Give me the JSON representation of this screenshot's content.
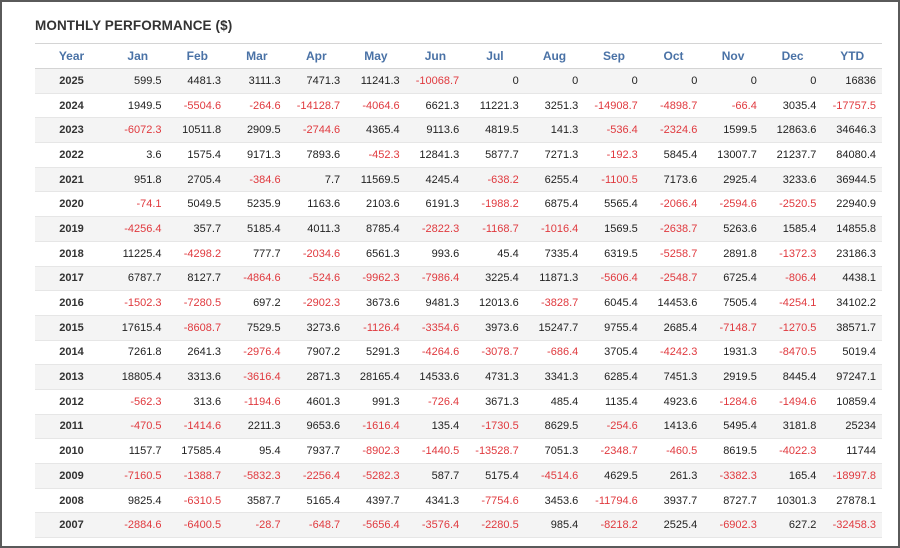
{
  "title": "MONTHLY PERFORMANCE ($)",
  "columns": [
    "Year",
    "Jan",
    "Feb",
    "Mar",
    "Apr",
    "May",
    "Jun",
    "Jul",
    "Aug",
    "Sep",
    "Oct",
    "Nov",
    "Dec",
    "YTD"
  ],
  "rows": [
    [
      "2025",
      "599.5",
      "4481.3",
      "3111.3",
      "7471.3",
      "11241.3",
      "-10068.7",
      "0",
      "0",
      "0",
      "0",
      "0",
      "0",
      "16836"
    ],
    [
      "2024",
      "1949.5",
      "-5504.6",
      "-264.6",
      "-14128.7",
      "-4064.6",
      "6621.3",
      "11221.3",
      "3251.3",
      "-14908.7",
      "-4898.7",
      "-66.4",
      "3035.4",
      "-17757.5"
    ],
    [
      "2023",
      "-6072.3",
      "10511.8",
      "2909.5",
      "-2744.6",
      "4365.4",
      "9113.6",
      "4819.5",
      "141.3",
      "-536.4",
      "-2324.6",
      "1599.5",
      "12863.6",
      "34646.3"
    ],
    [
      "2022",
      "3.6",
      "1575.4",
      "9171.3",
      "7893.6",
      "-452.3",
      "12841.3",
      "5877.7",
      "7271.3",
      "-192.3",
      "5845.4",
      "13007.7",
      "21237.7",
      "84080.4"
    ],
    [
      "2021",
      "951.8",
      "2705.4",
      "-384.6",
      "7.7",
      "11569.5",
      "4245.4",
      "-638.2",
      "6255.4",
      "-1100.5",
      "7173.6",
      "2925.4",
      "3233.6",
      "36944.5"
    ],
    [
      "2020",
      "-74.1",
      "5049.5",
      "5235.9",
      "1163.6",
      "2103.6",
      "6191.3",
      "-1988.2",
      "6875.4",
      "5565.4",
      "-2066.4",
      "-2594.6",
      "-2520.5",
      "22940.9"
    ],
    [
      "2019",
      "-4256.4",
      "357.7",
      "5185.4",
      "4011.3",
      "8785.4",
      "-2822.3",
      "-1168.7",
      "-1016.4",
      "1569.5",
      "-2638.7",
      "5263.6",
      "1585.4",
      "14855.8"
    ],
    [
      "2018",
      "11225.4",
      "-4298.2",
      "777.7",
      "-2034.6",
      "6561.3",
      "993.6",
      "45.4",
      "7335.4",
      "6319.5",
      "-5258.7",
      "2891.8",
      "-1372.3",
      "23186.3"
    ],
    [
      "2017",
      "6787.7",
      "8127.7",
      "-4864.6",
      "-524.6",
      "-9962.3",
      "-7986.4",
      "3225.4",
      "11871.3",
      "-5606.4",
      "-2548.7",
      "6725.4",
      "-806.4",
      "4438.1"
    ],
    [
      "2016",
      "-1502.3",
      "-7280.5",
      "697.2",
      "-2902.3",
      "3673.6",
      "9481.3",
      "12013.6",
      "-3828.7",
      "6045.4",
      "14453.6",
      "7505.4",
      "-4254.1",
      "34102.2"
    ],
    [
      "2015",
      "17615.4",
      "-8608.7",
      "7529.5",
      "3273.6",
      "-1126.4",
      "-3354.6",
      "3973.6",
      "15247.7",
      "9755.4",
      "2685.4",
      "-7148.7",
      "-1270.5",
      "38571.7"
    ],
    [
      "2014",
      "7261.8",
      "2641.3",
      "-2976.4",
      "7907.2",
      "5291.3",
      "-4264.6",
      "-3078.7",
      "-686.4",
      "3705.4",
      "-4242.3",
      "1931.3",
      "-8470.5",
      "5019.4"
    ],
    [
      "2013",
      "18805.4",
      "3313.6",
      "-3616.4",
      "2871.3",
      "28165.4",
      "14533.6",
      "4731.3",
      "3341.3",
      "6285.4",
      "7451.3",
      "2919.5",
      "8445.4",
      "97247.1"
    ],
    [
      "2012",
      "-562.3",
      "313.6",
      "-1194.6",
      "4601.3",
      "991.3",
      "-726.4",
      "3671.3",
      "485.4",
      "1135.4",
      "4923.6",
      "-1284.6",
      "-1494.6",
      "10859.4"
    ],
    [
      "2011",
      "-470.5",
      "-1414.6",
      "2211.3",
      "9653.6",
      "-1616.4",
      "135.4",
      "-1730.5",
      "8629.5",
      "-254.6",
      "1413.6",
      "5495.4",
      "3181.8",
      "25234"
    ],
    [
      "2010",
      "1157.7",
      "17585.4",
      "95.4",
      "7937.7",
      "-8902.3",
      "-1440.5",
      "-13528.7",
      "7051.3",
      "-2348.7",
      "-460.5",
      "8619.5",
      "-4022.3",
      "11744"
    ],
    [
      "2009",
      "-7160.5",
      "-1388.7",
      "-5832.3",
      "-2256.4",
      "-5282.3",
      "587.7",
      "5175.4",
      "-4514.6",
      "4629.5",
      "261.3",
      "-3382.3",
      "165.4",
      "-18997.8"
    ],
    [
      "2008",
      "9825.4",
      "-6310.5",
      "3587.7",
      "5165.4",
      "4397.7",
      "4341.3",
      "-7754.6",
      "3453.6",
      "-11794.6",
      "3937.7",
      "8727.7",
      "10301.3",
      "27878.1"
    ],
    [
      "2007",
      "-2884.6",
      "-6400.5",
      "-28.7",
      "-648.7",
      "-5656.4",
      "-3576.4",
      "-2280.5",
      "985.4",
      "-8218.2",
      "2525.4",
      "-6902.3",
      "627.2",
      "-32458.3"
    ]
  ],
  "colors": {
    "header": "#4a72a6",
    "negative": "#e0393e",
    "text": "#222222",
    "stripe": "#f4f4f4"
  }
}
